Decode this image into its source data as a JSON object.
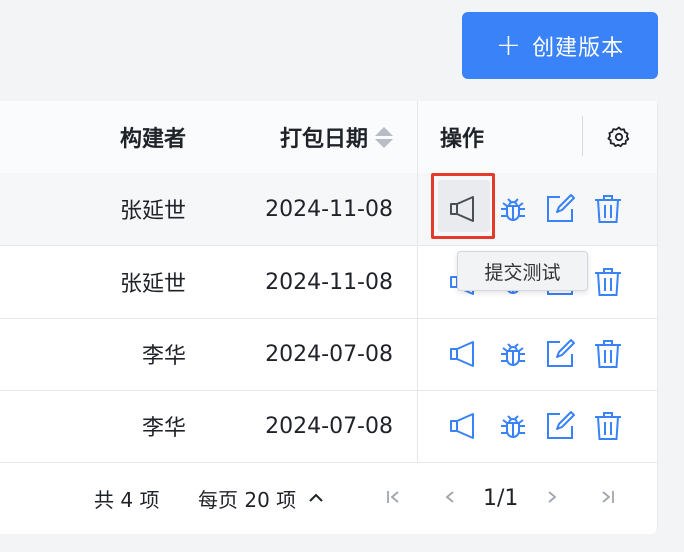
{
  "toolbar": {
    "create_label": "创建版本"
  },
  "table": {
    "headers": {
      "builder": "构建者",
      "date": "打包日期",
      "ops": "操作"
    },
    "rows": [
      {
        "builder": "张延世",
        "date": "2024-11-08"
      },
      {
        "builder": "张延世",
        "date": "2024-11-08"
      },
      {
        "builder": "李华",
        "date": "2024-07-08"
      },
      {
        "builder": "李华",
        "date": "2024-07-08"
      }
    ]
  },
  "tooltip": {
    "text": "提交测试"
  },
  "pagination": {
    "total": "共 4 项",
    "page_size": "每页 20 项",
    "page": "1/1"
  },
  "colors": {
    "accent": "#3a82f7",
    "highlight": "#e33a2c"
  },
  "icons": [
    "plus-icon",
    "settings-gear-icon",
    "sort-icon",
    "megaphone-icon",
    "bug-icon",
    "edit-icon",
    "trash-icon",
    "chevron-up-icon",
    "first-page-icon",
    "prev-page-icon",
    "next-page-icon",
    "last-page-icon"
  ]
}
